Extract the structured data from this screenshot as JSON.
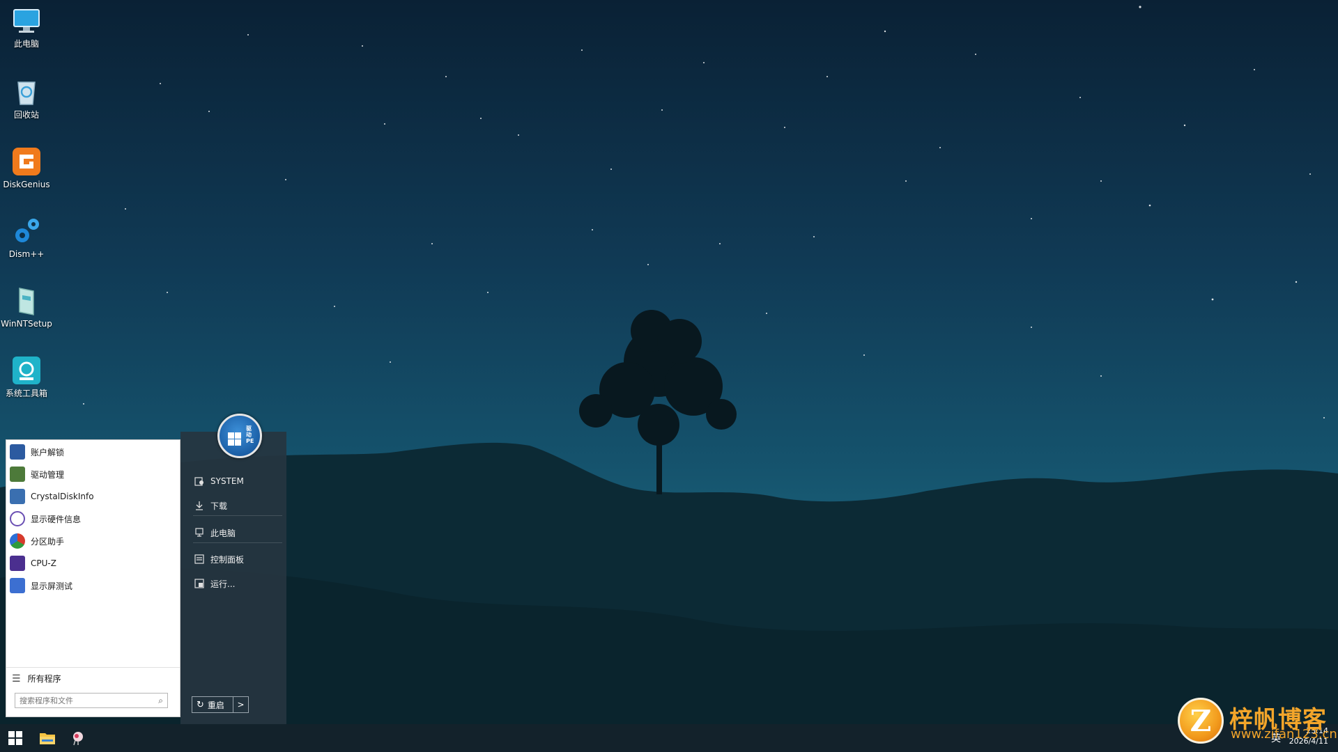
{
  "desktop": {
    "icons": [
      {
        "label": "此电脑",
        "icon": "computer-icon"
      },
      {
        "label": "回收站",
        "icon": "recycle-bin-icon"
      },
      {
        "label": "DiskGenius",
        "icon": "diskgenius-icon"
      },
      {
        "label": "Dism++",
        "icon": "gears-icon"
      },
      {
        "label": "WinNTSetup",
        "icon": "setup-icon"
      },
      {
        "label": "系统工具箱",
        "icon": "toolbox-icon"
      }
    ]
  },
  "start_menu": {
    "avatar_text": "驱动PE",
    "programs": [
      {
        "label": "账户解锁",
        "icon": "account-unlock-icon",
        "color": "#2c5aa0"
      },
      {
        "label": "驱动管理",
        "icon": "driver-manager-icon",
        "color": "#4d7a3a"
      },
      {
        "label": "CrystalDiskInfo",
        "icon": "crystaldiskinfo-icon",
        "color": "#3a6fb0"
      },
      {
        "label": "显示硬件信息",
        "icon": "hardware-info-icon",
        "color": "#6a4fb3"
      },
      {
        "label": "分区助手",
        "icon": "partition-assistant-icon",
        "color": "#d63a2c"
      },
      {
        "label": "CPU-Z",
        "icon": "cpuz-icon",
        "color": "#4b2f8f"
      },
      {
        "label": "显示屏测试",
        "icon": "screen-test-icon",
        "color": "#3c6fd1"
      }
    ],
    "all_programs": "所有程序",
    "search_placeholder": "搜索程序和文件",
    "places": [
      {
        "label": "SYSTEM",
        "icon": "user-folder-icon"
      },
      {
        "label": "下载",
        "icon": "download-icon"
      },
      {
        "label": "此电脑",
        "icon": "computer-icon"
      },
      {
        "label": "控制面板",
        "icon": "control-panel-icon"
      },
      {
        "label": "运行...",
        "icon": "run-icon"
      }
    ],
    "restart_label": "重启",
    "power_arrow": ">"
  },
  "taskbar": {
    "ime": "英",
    "time": "23:14",
    "date": "2026/4/11"
  },
  "watermark": {
    "title": "梓帆博客",
    "url": "www.zifan123.cn",
    "logo_letter": "Z"
  }
}
